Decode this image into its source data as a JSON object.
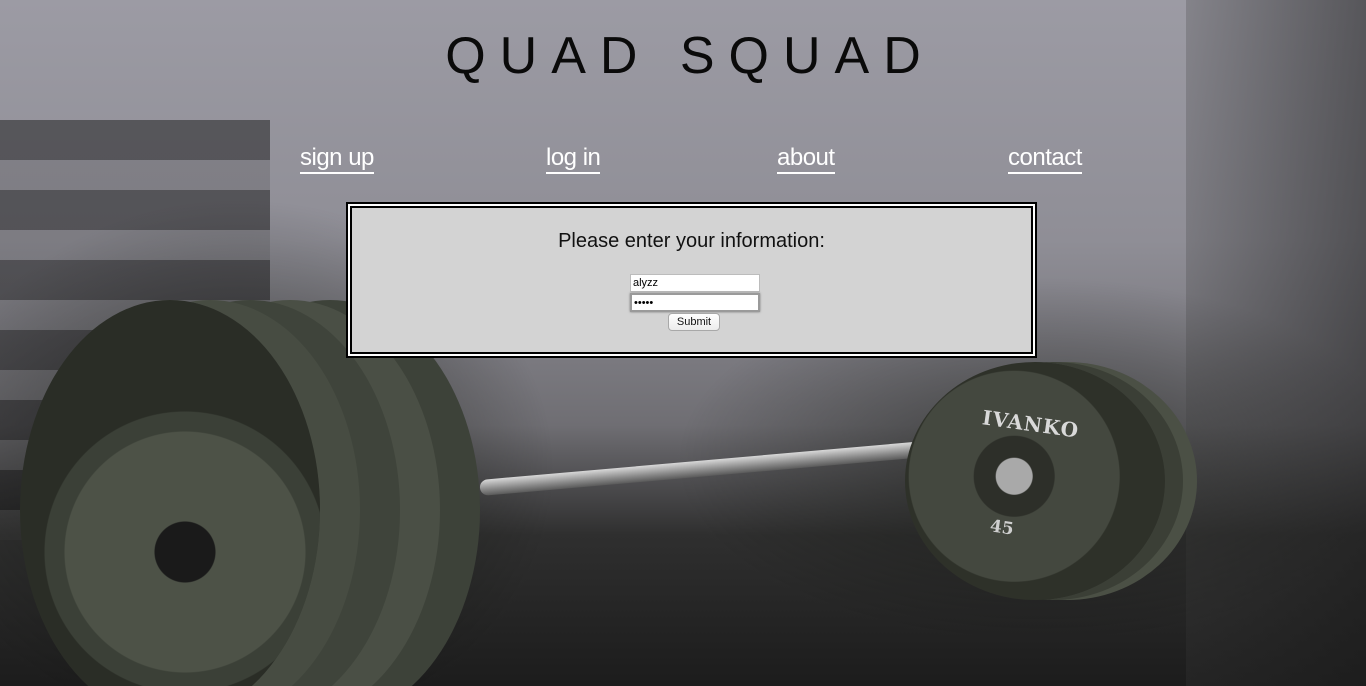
{
  "header": {
    "title": "QUAD SQUAD"
  },
  "nav": {
    "items": [
      {
        "label": "sign up"
      },
      {
        "label": "log in"
      },
      {
        "label": "about"
      },
      {
        "label": "contact"
      }
    ]
  },
  "form": {
    "heading": "Please enter your information:",
    "username_value": "alyzz",
    "password_value": "•••••",
    "submit_label": "Submit"
  },
  "background": {
    "plate_brand": "IVANKO",
    "plate_weight": "45"
  }
}
